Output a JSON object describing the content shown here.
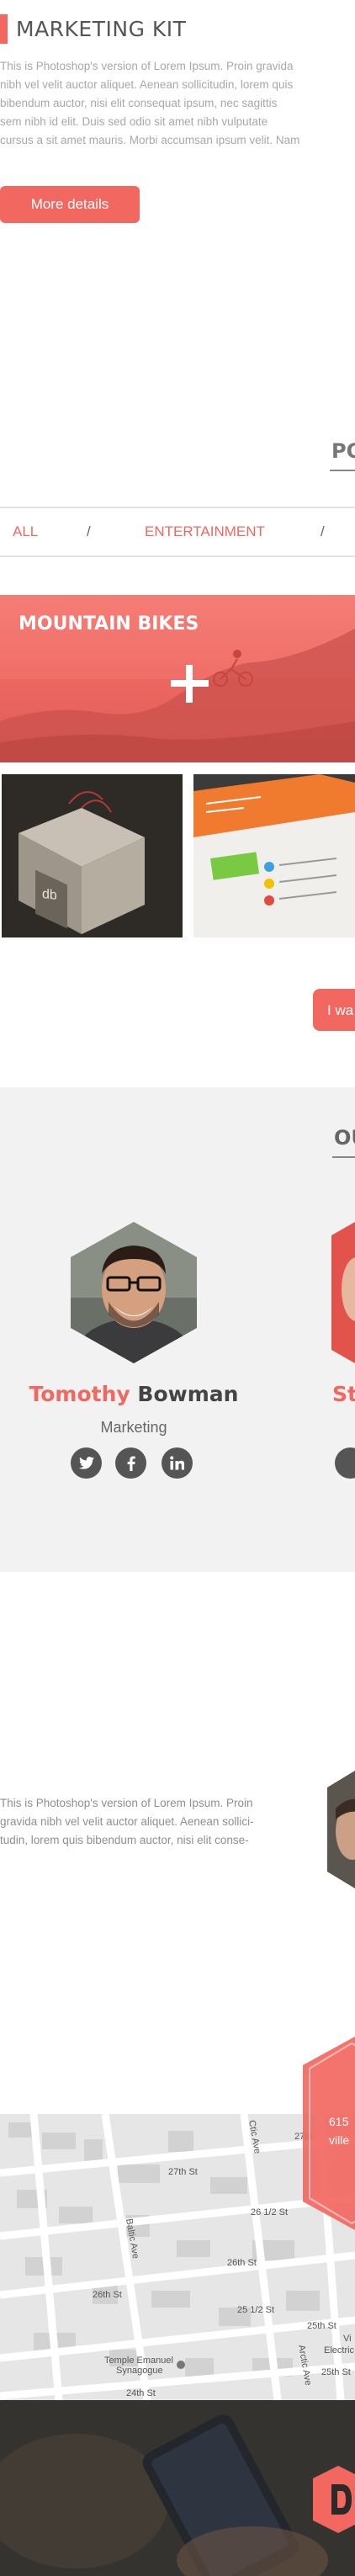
{
  "kit": {
    "title": "MARKETING KIT",
    "paragraph_lines": [
      "This is Photoshop's version  of Lorem Ipsum. Proin gravida",
      "nibh vel velit auctor aliquet. Aenean sollicitudin, lorem quis",
      "bibendum auctor, nisi elit consequat ipsum, nec sagittis",
      "sem nibh id elit. Duis sed odio sit amet nibh vulputate",
      "cursus a sit amet mauris. Morbi accumsan ipsum velit. Nam"
    ],
    "button_label": "More details"
  },
  "portfolio": {
    "title": "PO",
    "filters": [
      "ALL",
      "ENTERTAINMENT"
    ],
    "separator": "/",
    "featured_label": "MOUNTAIN BIKES",
    "cta_label": "I wa"
  },
  "team": {
    "title": "OU",
    "members": [
      {
        "first_name": "Tomothy",
        "last_name": "Bowman",
        "role": "Marketing",
        "socials": [
          "twitter-icon",
          "facebook-icon",
          "linkedin-icon"
        ]
      },
      {
        "first_name": "St",
        "last_name": "",
        "role": "",
        "socials": [
          "twitter-icon"
        ]
      }
    ]
  },
  "testimonial": {
    "lines": [
      "This is Photoshop's version  of Lorem Ipsum. Proin",
      "gravida nibh vel velit auctor aliquet. Aenean sollici-",
      "tudin, lorem quis bibendum auctor, nisi elit conse-"
    ]
  },
  "contact": {
    "address_lines": [
      "615",
      "ville"
    ]
  },
  "map": {
    "streets": [
      "27th St",
      "27th",
      "26 1/2 St",
      "26th St",
      "26th St",
      "25 1/2 St",
      "25th St",
      "25th St",
      "24th St",
      "Baltic Ave",
      "Ctic Ave",
      "Arctic Ave",
      "Temple Emanuel",
      "Synagogue",
      "Electric",
      "Vi"
    ]
  },
  "colors": {
    "accent": "#f26861",
    "team_bg": "#f2f2f2",
    "text_muted": "#a8a8a8"
  }
}
